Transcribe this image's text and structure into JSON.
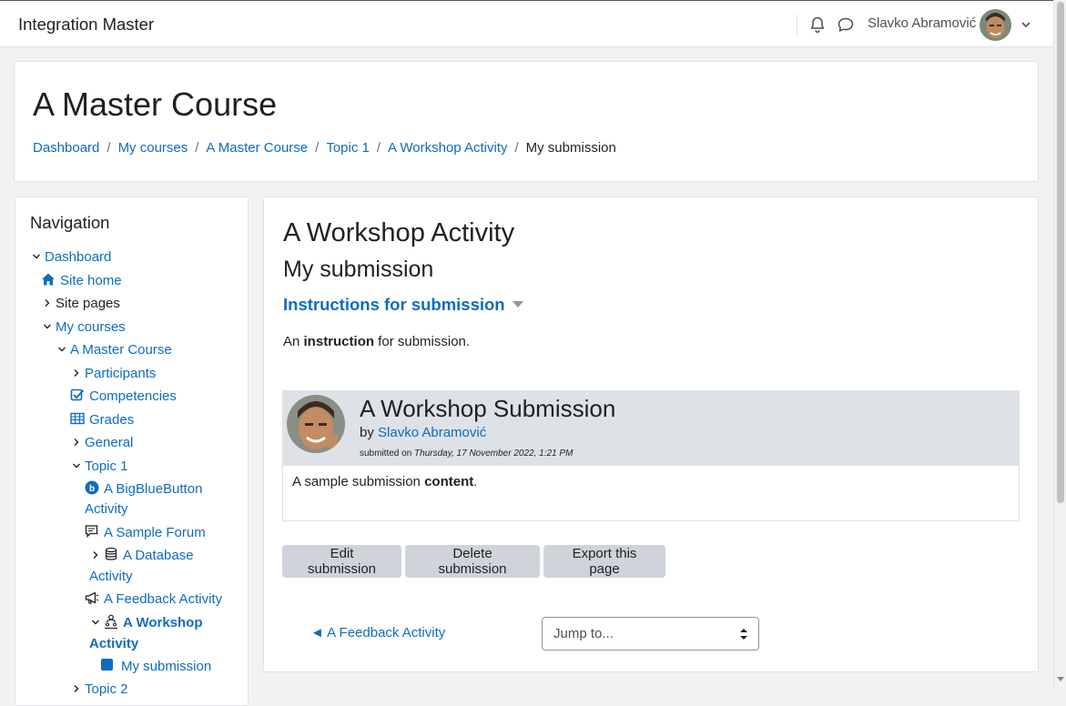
{
  "topbar": {
    "site_name": "Integration Master",
    "user_name": "Slavko Abramović",
    "icons": [
      "bell-icon",
      "chat-icon",
      "chevron-down-icon"
    ]
  },
  "header": {
    "course_title": "A Master Course",
    "breadcrumb": [
      "Dashboard",
      "My courses",
      "A Master Course",
      "Topic 1",
      "A Workshop Activity",
      "My submission"
    ],
    "separator": "/"
  },
  "navigation": {
    "title": "Navigation",
    "items": [
      {
        "label": "Dashboard",
        "icon": "chevron-down"
      },
      {
        "label": "Site home",
        "icon": "home-icon"
      },
      {
        "label": "Site pages",
        "icon": "chevron-right"
      },
      {
        "label": "My courses",
        "icon": "chevron-down"
      },
      {
        "label": "A Master Course",
        "icon": "chevron-down"
      },
      {
        "label": "Participants",
        "icon": "chevron-right"
      },
      {
        "label": "Competencies",
        "icon": "checkbox-icon"
      },
      {
        "label": "Grades",
        "icon": "table-icon"
      },
      {
        "label": "General",
        "icon": "chevron-right"
      },
      {
        "label": "Topic 1",
        "icon": "chevron-down"
      },
      {
        "label": "A BigBlueButton Activity",
        "icon": "bigbluebutton-icon"
      },
      {
        "label": "A Sample Forum",
        "icon": "forum-icon"
      },
      {
        "label": "A Database Activity",
        "icon": "database-icon"
      },
      {
        "label": "A Feedback Activity",
        "icon": "megaphone-icon"
      },
      {
        "label": "A Workshop Activity",
        "icon": "workshop-icon"
      },
      {
        "label": "My submission",
        "icon": "square-icon"
      },
      {
        "label": "Topic 2",
        "icon": "chevron-right"
      }
    ]
  },
  "main": {
    "activity_title": "A Workshop Activity",
    "page_title": "My submission",
    "instructions_heading": "Instructions for submission",
    "instructions_pre": "An ",
    "instructions_bold": "instruction",
    "instructions_post": " for submission.",
    "submission": {
      "title": "A Workshop Submission",
      "by_label": "by",
      "author": "Slavko Abramović",
      "submitted_label": "submitted on",
      "submitted_date": "Thursday, 17 November 2022, 1:21 PM",
      "content_pre": "A sample submission ",
      "content_bold": "content",
      "content_post": "."
    },
    "buttons": {
      "edit": "Edit submission",
      "delete": "Delete submission",
      "export": "Export this page"
    },
    "prev_activity": "◄ A Feedback Activity",
    "jump_to": "Jump to..."
  },
  "colors": {
    "link": "#0f6cbf",
    "button_bg": "#ced4da",
    "submission_header_bg": "#dee2e6"
  }
}
